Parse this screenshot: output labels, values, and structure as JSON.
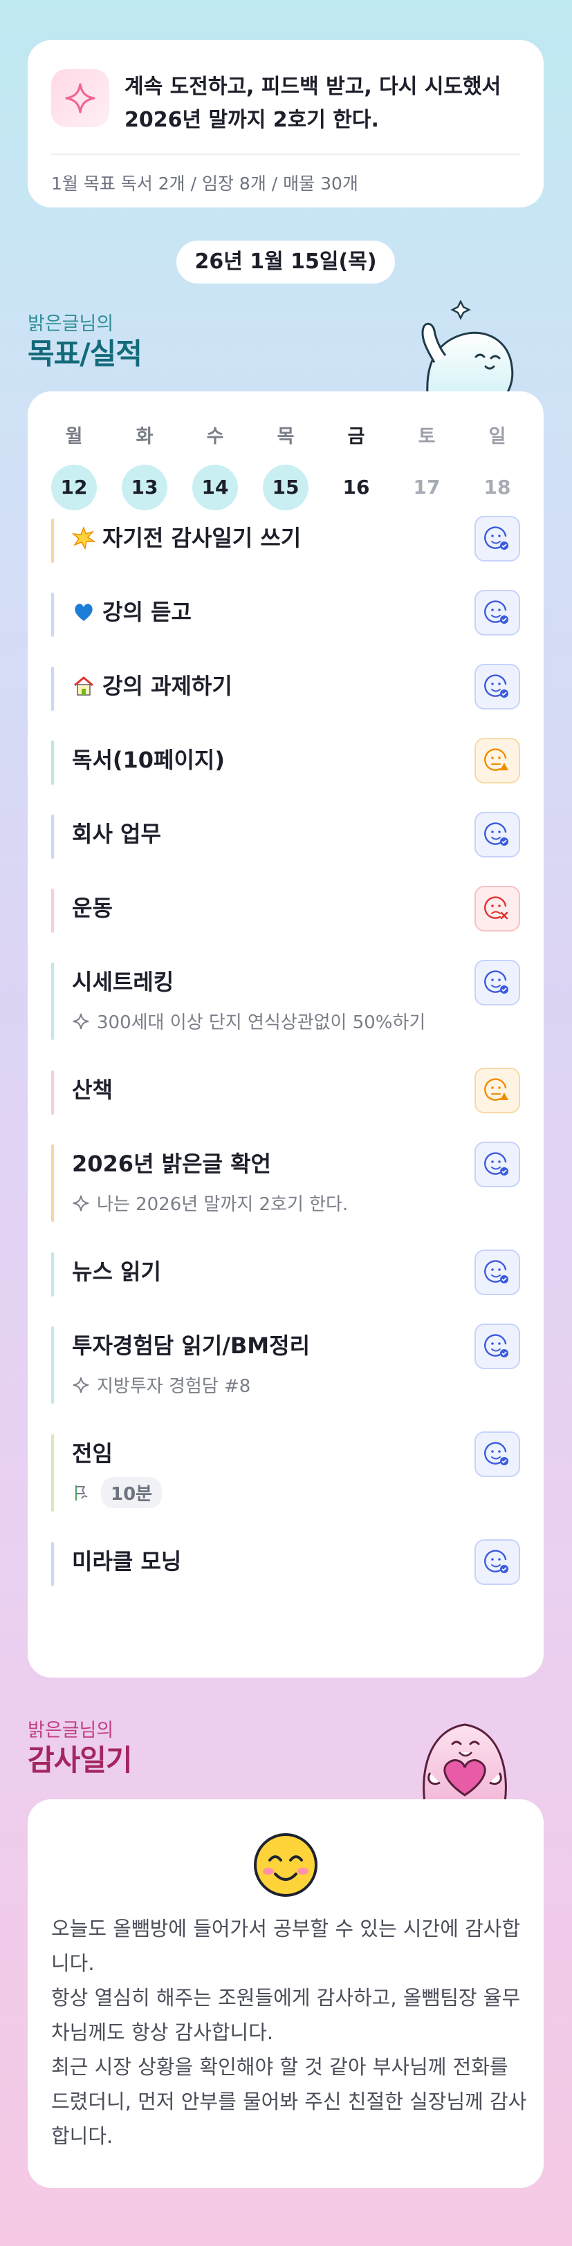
{
  "mission": {
    "icon": "sparkle-icon",
    "text": "계속 도전하고, 피드백 받고, 다시 시도했서 2026년 말까지 2호기 한다.",
    "monthly_goal": "1월 목표  독서 2개 / 임장 8개 / 매물 30개"
  },
  "date": "26년 1월 15일(목)",
  "goals_section": {
    "subtitle": "밝은글님의",
    "title": "목표/실적"
  },
  "week": [
    {
      "name": "월",
      "date": "12",
      "state": "done"
    },
    {
      "name": "화",
      "date": "13",
      "state": "done"
    },
    {
      "name": "수",
      "date": "14",
      "state": "done"
    },
    {
      "name": "목",
      "date": "15",
      "state": "done"
    },
    {
      "name": "금",
      "date": "16",
      "state": "today"
    },
    {
      "name": "토",
      "date": "17",
      "state": "future"
    },
    {
      "name": "일",
      "date": "18",
      "state": "future"
    }
  ],
  "tasks": [
    {
      "label": "자기전 감사일기 쓰기",
      "emoji": "star-burst-icon",
      "status": "done",
      "bar": "#f7d5a8"
    },
    {
      "label": "강의 듣고",
      "emoji": "blue-heart-icon",
      "status": "done",
      "bar": "#c9d9f6"
    },
    {
      "label": "강의 과제하기",
      "emoji": "house-icon",
      "status": "done",
      "bar": "#c9d9f6"
    },
    {
      "label": "독서(10페이지)",
      "status": "partial",
      "bar": "#bfe6d6"
    },
    {
      "label": "회사 업무",
      "status": "done",
      "bar": "#c9d9f6"
    },
    {
      "label": "운동",
      "status": "fail",
      "bar": "#f6cde0"
    },
    {
      "label": "시세트레킹",
      "status": "done",
      "bar": "#c3e7ea",
      "sub": "300세대 이상 단지 연식상관없이 50%하기"
    },
    {
      "label": "산책",
      "status": "partial",
      "bar": "#f6cde0"
    },
    {
      "label": "2026년 밝은글 확언",
      "status": "done",
      "bar": "#f7d5a8",
      "sub": "나는 2026년 말까지 2호기 한다."
    },
    {
      "label": "뉴스 읽기",
      "status": "done",
      "bar": "#c3e7ea"
    },
    {
      "label": "투자경험담 읽기/BM정리",
      "status": "done",
      "bar": "#c3e7ea",
      "sub": "지방투자 경험담 #8"
    },
    {
      "label": "전임",
      "status": "done",
      "bar": "#d5ebb8",
      "chip": "10분"
    },
    {
      "label": "미라클 모닝",
      "status": "done",
      "bar": "#c9d9f6"
    }
  ],
  "status_icons": {
    "done": "smile-check-icon",
    "partial": "smile-warning-icon",
    "fail": "sad-x-icon"
  },
  "gratitude_section": {
    "subtitle": "밝은글님의",
    "title": "감사일기"
  },
  "gratitude": {
    "mood_icon": "blushing-smile-icon",
    "text": "오늘도 올뺌방에 들어가서 공부할 수 있는 시간에 감사합니다.\n항상 열심히 해주는 조원들에게 감사하고, 올뺌팀장 율무차님께도 항상 감사합니다.\n최근 시장 상황을 확인해야 할 것 같아 부사님께 전화를 드렸더니, 먼저 안부를 물어봐 주신 친절한 실장님께 감사합니다."
  },
  "colors": {
    "done": "#3b5bdb",
    "partial": "#f08c00",
    "fail": "#e03131",
    "goals_title": "#136a7a",
    "gratitude_title": "#a3265f"
  }
}
